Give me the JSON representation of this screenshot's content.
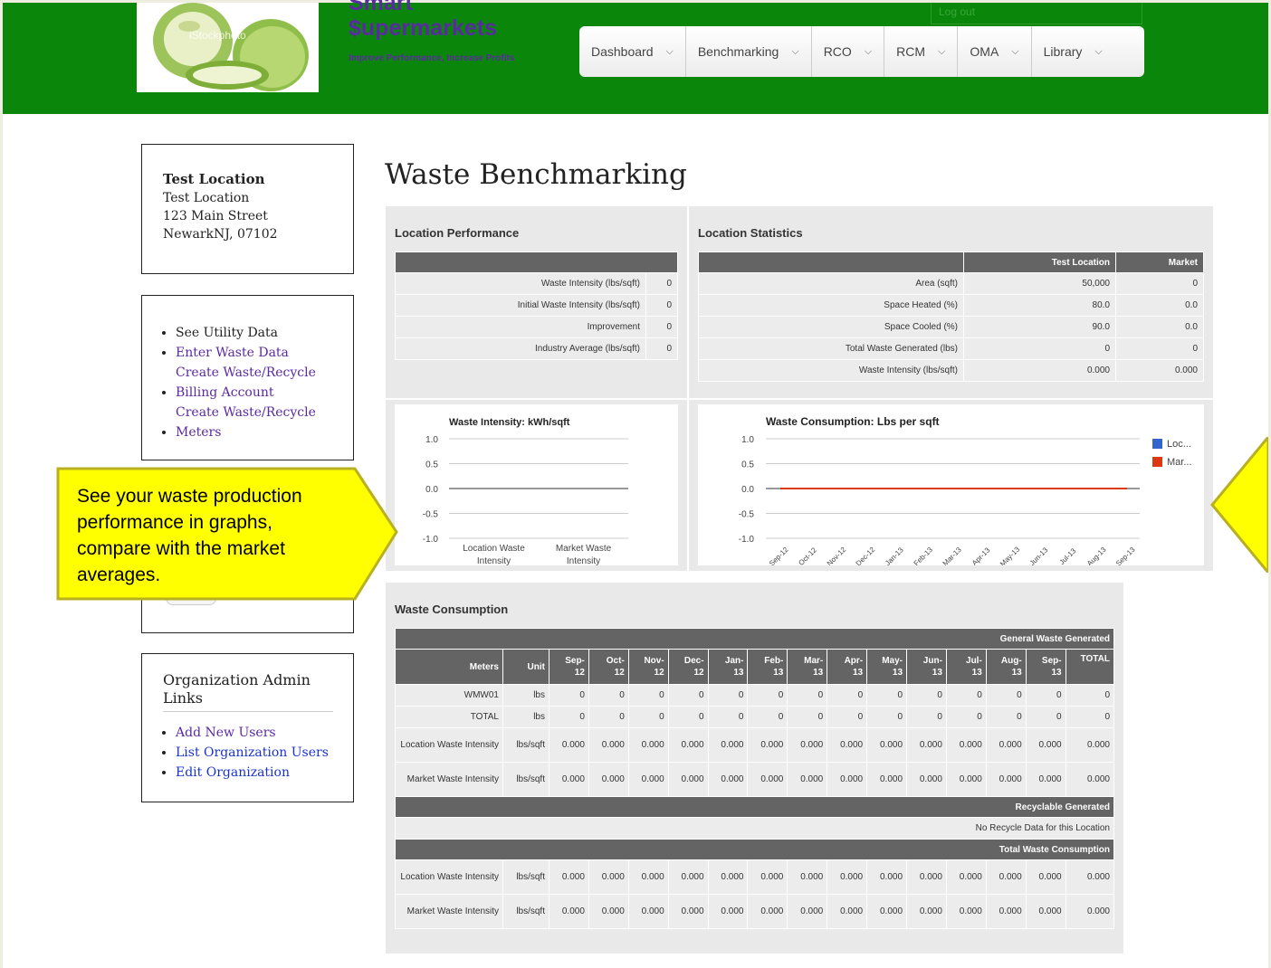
{
  "brand": {
    "name": "Smart\n$upermarkets",
    "name_line1": "Smart",
    "name_line2": "$upermarkets",
    "tagline": "Improve Performance, Increase Profits",
    "watermark": "iStockphoto"
  },
  "header": {
    "logout": "Log out"
  },
  "nav": [
    {
      "label": "Dashboard"
    },
    {
      "label": "Benchmarking"
    },
    {
      "label": "RCO"
    },
    {
      "label": "RCM"
    },
    {
      "label": "OMA"
    },
    {
      "label": "Library"
    }
  ],
  "location": {
    "name": "Test Location",
    "line1": "Test Location",
    "line2": "123 Main Street",
    "line3": "NewarkNJ, 07102"
  },
  "side_links": [
    {
      "label": "See Utility Data"
    },
    {
      "label": "Enter Waste Data"
    },
    {
      "label": "Create Waste/Recycle Billing Account"
    },
    {
      "label": "Create Waste/Recycle Meters"
    }
  ],
  "admin": {
    "title": "Organization Admin Links",
    "links": [
      {
        "label": "Add New Users"
      },
      {
        "label": "List Organization Users"
      },
      {
        "label": "Edit Organization"
      }
    ]
  },
  "page_title": "Waste Benchmarking",
  "performance": {
    "title": "Location Performance",
    "rows": [
      {
        "label": "Waste Intensity (lbs/sqft)",
        "value": "0"
      },
      {
        "label": "Initial Waste Intensity (lbs/sqft)",
        "value": "0"
      },
      {
        "label": "Improvement",
        "value": "0"
      },
      {
        "label": "Industry Average (lbs/sqft)",
        "value": "0"
      }
    ]
  },
  "statistics": {
    "title": "Location Statistics",
    "col_location": "Test Location",
    "col_market": "Market",
    "rows": [
      {
        "label": "Area (sqft)",
        "location": "50,000",
        "market": "0"
      },
      {
        "label": "Space Heated (%)",
        "location": "80.0",
        "market": "0.0"
      },
      {
        "label": "Space Cooled (%)",
        "location": "90.0",
        "market": "0.0"
      },
      {
        "label": "Total Waste Generated (lbs)",
        "location": "0",
        "market": "0"
      },
      {
        "label": "Waste Intensity (lbs/sqft)",
        "location": "0.000",
        "market": "0.000"
      }
    ]
  },
  "chart_data": [
    {
      "type": "bar",
      "title": "Waste Intensity: kWh/sqft",
      "categories": [
        "Location Waste Intensity",
        "Market Waste Intensity"
      ],
      "values": [
        0,
        0
      ],
      "yticks": [
        "1.0",
        "0.5",
        "0.0",
        "-0.5",
        "-1.0"
      ],
      "ylim": [
        -1,
        1
      ],
      "grid": true
    },
    {
      "type": "line",
      "title": "Waste Consumption: Lbs per sqft",
      "x": [
        "Sep-12",
        "Oct-12",
        "Nov-12",
        "Dec-12",
        "Jan-13",
        "Feb-13",
        "Mar-13",
        "Apr-13",
        "May-13",
        "Jun-13",
        "Jul-13",
        "Aug-13",
        "Sep-13"
      ],
      "series": [
        {
          "name": "Loc...",
          "color": "#3366cc",
          "values": [
            0,
            0,
            0,
            0,
            0,
            0,
            0,
            0,
            0,
            0,
            0,
            0,
            0
          ]
        },
        {
          "name": "Mar...",
          "color": "#dc3912",
          "values": [
            0,
            0,
            0,
            0,
            0,
            0,
            0,
            0,
            0,
            0,
            0,
            0,
            0
          ]
        }
      ],
      "yticks": [
        "1.0",
        "0.5",
        "0.0",
        "-0.5",
        "-1.0"
      ],
      "ylim": [
        -1,
        1
      ],
      "legend": "right",
      "grid": true
    }
  ],
  "consumption": {
    "title": "Waste Consumption",
    "section_general": "General Waste Generated",
    "section_recycle": "Recyclable Generated",
    "section_total": "Total Waste Consumption",
    "no_recycle": "No Recycle Data for this Location",
    "col_meters": "Meters",
    "col_unit": "Unit",
    "months": [
      "Sep-\n12",
      "Oct-\n12",
      "Nov-\n12",
      "Dec-\n12",
      "Jan-\n13",
      "Feb-\n13",
      "Mar-\n13",
      "Apr-\n13",
      "May-\n13",
      "Jun-\n13",
      "Jul-\n13",
      "Aug-\n13",
      "Sep-\n13"
    ],
    "col_total": "TOTAL",
    "general_rows": [
      {
        "meter": "WMW01",
        "unit": "lbs",
        "values": [
          "0",
          "0",
          "0",
          "0",
          "0",
          "0",
          "0",
          "0",
          "0",
          "0",
          "0",
          "0",
          "0"
        ],
        "total": "0"
      },
      {
        "meter": "TOTAL",
        "unit": "lbs",
        "values": [
          "0",
          "0",
          "0",
          "0",
          "0",
          "0",
          "0",
          "0",
          "0",
          "0",
          "0",
          "0",
          "0"
        ],
        "total": "0"
      },
      {
        "meter": "Location Waste Intensity",
        "unit": "lbs/sqft",
        "values": [
          "0.000",
          "0.000",
          "0.000",
          "0.000",
          "0.000",
          "0.000",
          "0.000",
          "0.000",
          "0.000",
          "0.000",
          "0.000",
          "0.000",
          "0.000"
        ],
        "total": "0.000"
      },
      {
        "meter": "Market Waste Intensity",
        "unit": "lbs/sqft",
        "values": [
          "0.000",
          "0.000",
          "0.000",
          "0.000",
          "0.000",
          "0.000",
          "0.000",
          "0.000",
          "0.000",
          "0.000",
          "0.000",
          "0.000",
          "0.000"
        ],
        "total": "0.000"
      }
    ],
    "total_rows": [
      {
        "meter": "Location Waste Intensity",
        "unit": "lbs/sqft",
        "values": [
          "0.000",
          "0.000",
          "0.000",
          "0.000",
          "0.000",
          "0.000",
          "0.000",
          "0.000",
          "0.000",
          "0.000",
          "0.000",
          "0.000",
          "0.000"
        ],
        "total": "0.000"
      },
      {
        "meter": "Market Waste Intensity",
        "unit": "lbs/sqft",
        "values": [
          "0.000",
          "0.000",
          "0.000",
          "0.000",
          "0.000",
          "0.000",
          "0.000",
          "0.000",
          "0.000",
          "0.000",
          "0.000",
          "0.000",
          "0.000"
        ],
        "total": "0.000"
      }
    ]
  },
  "callout": {
    "text": "See your waste production performance in graphs, compare with the market averages."
  },
  "colors": {
    "header_green": "#0a870a",
    "brand_purple": "#5a2aa0",
    "callout_yellow": "#ffff00",
    "table_header": "#646464"
  }
}
